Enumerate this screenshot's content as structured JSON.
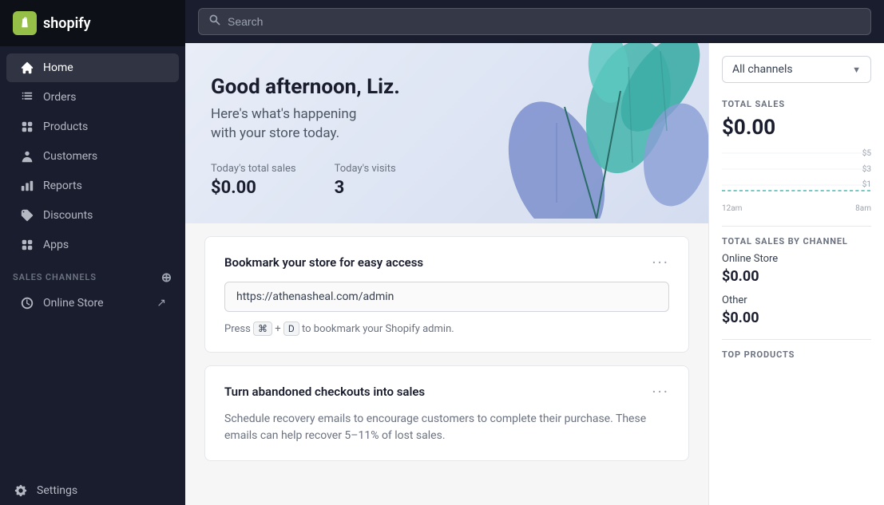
{
  "sidebar": {
    "logo": {
      "text": "shopify",
      "icon": "🛍"
    },
    "nav_items": [
      {
        "id": "home",
        "label": "Home",
        "active": true
      },
      {
        "id": "orders",
        "label": "Orders",
        "active": false
      },
      {
        "id": "products",
        "label": "Products",
        "active": false
      },
      {
        "id": "customers",
        "label": "Customers",
        "active": false
      },
      {
        "id": "reports",
        "label": "Reports",
        "active": false
      },
      {
        "id": "discounts",
        "label": "Discounts",
        "active": false
      },
      {
        "id": "apps",
        "label": "Apps",
        "active": false
      }
    ],
    "sales_channels_label": "SALES CHANNELS",
    "online_store": "Online Store",
    "settings": "Settings"
  },
  "topbar": {
    "search_placeholder": "Search"
  },
  "hero": {
    "greeting": "Good afternoon, Liz.",
    "subtitle_line1": "Here's what's happening",
    "subtitle_line2": "with your store today.",
    "stat1_label": "Today's total sales",
    "stat1_value": "$0.00",
    "stat2_label": "Today's visits",
    "stat2_value": "3"
  },
  "cards": [
    {
      "id": "bookmark",
      "title": "Bookmark your store for easy access",
      "url": "https://athenasheal.com/admin",
      "hint_prefix": "Press",
      "hint_key1": "⌘",
      "hint_plus": "+",
      "hint_key2": "D",
      "hint_suffix": "to bookmark your Shopify admin.",
      "menu_label": "···"
    },
    {
      "id": "abandoned",
      "title": "Turn abandoned checkouts into sales",
      "description": "Schedule recovery emails to encourage customers to complete their purchase. These emails can help recover 5–11% of lost sales.",
      "menu_label": "···"
    }
  ],
  "right_panel": {
    "channel_selector": {
      "label": "All channels",
      "dropdown_arrow": "▼"
    },
    "total_sales_label": "TOTAL SALES",
    "total_sales_value": "$0.00",
    "chart_y_labels": [
      "$5",
      "$3",
      "$1"
    ],
    "chart_x_left": "12am",
    "chart_x_right": "8am",
    "total_by_channel_label": "TOTAL SALES BY CHANNEL",
    "channels": [
      {
        "name": "Online Store",
        "value": "$0.00"
      },
      {
        "name": "Other",
        "value": "$0.00"
      }
    ],
    "top_products_label": "TOP PRODUCTS"
  }
}
